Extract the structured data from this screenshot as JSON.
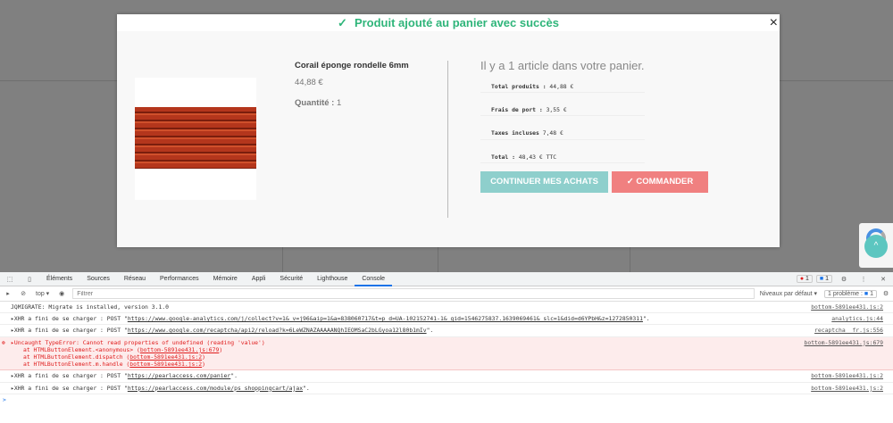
{
  "modal": {
    "header": "Produit ajouté au panier avec succès",
    "close": "×",
    "product": {
      "name": "Corail éponge rondelle 6mm",
      "price": "44,88 €",
      "quantity_label": "Quantité :",
      "quantity": "1"
    },
    "cart": {
      "title": "Il y a 1 article dans votre panier.",
      "total_products_label": "Total produits :",
      "total_products": "44,88 €",
      "shipping_label": "Frais de port :",
      "shipping": "3,55 €",
      "taxes_label": "Taxes incluses",
      "taxes": "7,48 €",
      "total_label": "Total :",
      "total": "48,43 € TTC"
    },
    "continue_button": "CONTINUER MES ACHATS",
    "order_button": "COMMANDER"
  },
  "devtools": {
    "tabs": [
      "Éléments",
      "Sources",
      "Réseau",
      "Performances",
      "Mémoire",
      "Appli",
      "Sécurité",
      "Lighthouse",
      "Console"
    ],
    "error_count": "1",
    "message_count": "1",
    "context": "top",
    "filter_placeholder": "Filtrer",
    "levels": "Niveaux par défaut",
    "problems": "1 problème :",
    "problems_count": "1",
    "logs": [
      {
        "text": "JQMIGRATE: Migrate is installed, version 3.1.0",
        "source": "bottom-5891ee431.js:2"
      },
      {
        "prefix": "XHR a fini de se charger : POST \"",
        "url": "https://www.google-analytics.com/j/collect?v=1&_v=j96&aip=1&a=838060717&t=p_d=UA-102152741-1&_gid=1546275837.1639069461&_slc=1&did=d6YPbH&z=1272850311",
        "suffix": "\".",
        "source": "analytics.js:44"
      },
      {
        "prefix": "XHR a fini de se charger : POST \"",
        "url": "https://www.google.com/recaptcha/api2/reload?k=6LeWZNAZAAAAANQhIEOMSaC2bLGyoa12l80b1mIv",
        "suffix": "\".",
        "source": "recaptcha__fr.js:556"
      },
      {
        "error": "Uncaught TypeError: Cannot read properties of undefined (reading 'value')",
        "source": "bottom-5891ee431.js:679",
        "stack": [
          {
            "at": "at HTMLButtonElement.<anonymous> (",
            "link": "bottom-5891ee431.js:679"
          },
          {
            "at": "at HTMLButtonElement.dispatch (",
            "link": "bottom-5891ee431.js:2"
          },
          {
            "at": "at HTMLButtonElement.m.handle (",
            "link": "bottom-5891ee431.js:2"
          }
        ]
      },
      {
        "prefix": "XHR a fini de se charger : POST \"",
        "url": "https://pearlaccess.com/panier",
        "suffix": "\".",
        "source": "bottom-5891ee431.js:2"
      },
      {
        "prefix": "XHR a fini de se charger : POST \"",
        "url": "https://pearlaccess.com/module/ps_shoppingcart/ajax",
        "suffix": "\".",
        "source": "bottom-5891ee431.js:2"
      }
    ],
    "prompt": ">"
  }
}
